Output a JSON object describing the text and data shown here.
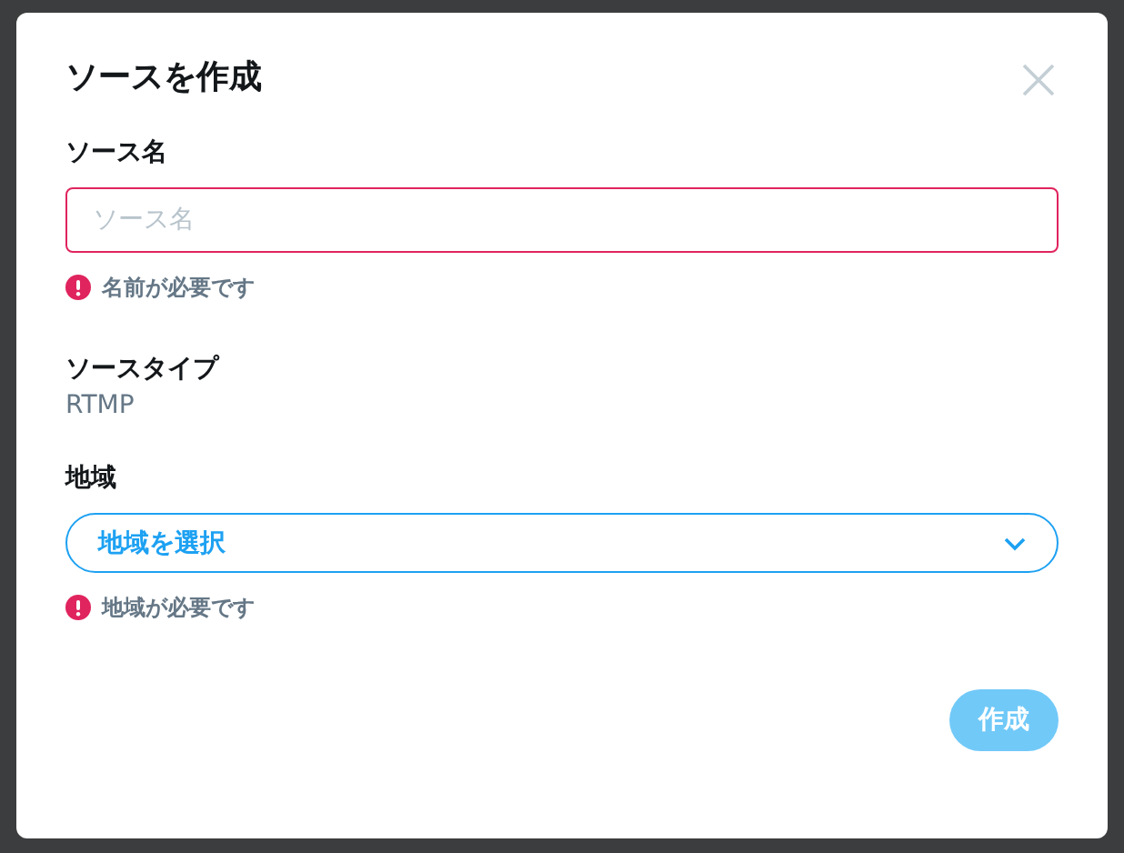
{
  "dialog": {
    "title": "ソースを作成",
    "name_field": {
      "label": "ソース名",
      "placeholder": "ソース名",
      "invalid": true,
      "error": "名前が必要です"
    },
    "source_type": {
      "label": "ソースタイプ",
      "value": "RTMP"
    },
    "region_field": {
      "label": "地域",
      "placeholder": "地域を選択",
      "invalid": true,
      "error": "地域が必要です"
    },
    "submit": {
      "label": "作成",
      "disabled": true
    }
  }
}
